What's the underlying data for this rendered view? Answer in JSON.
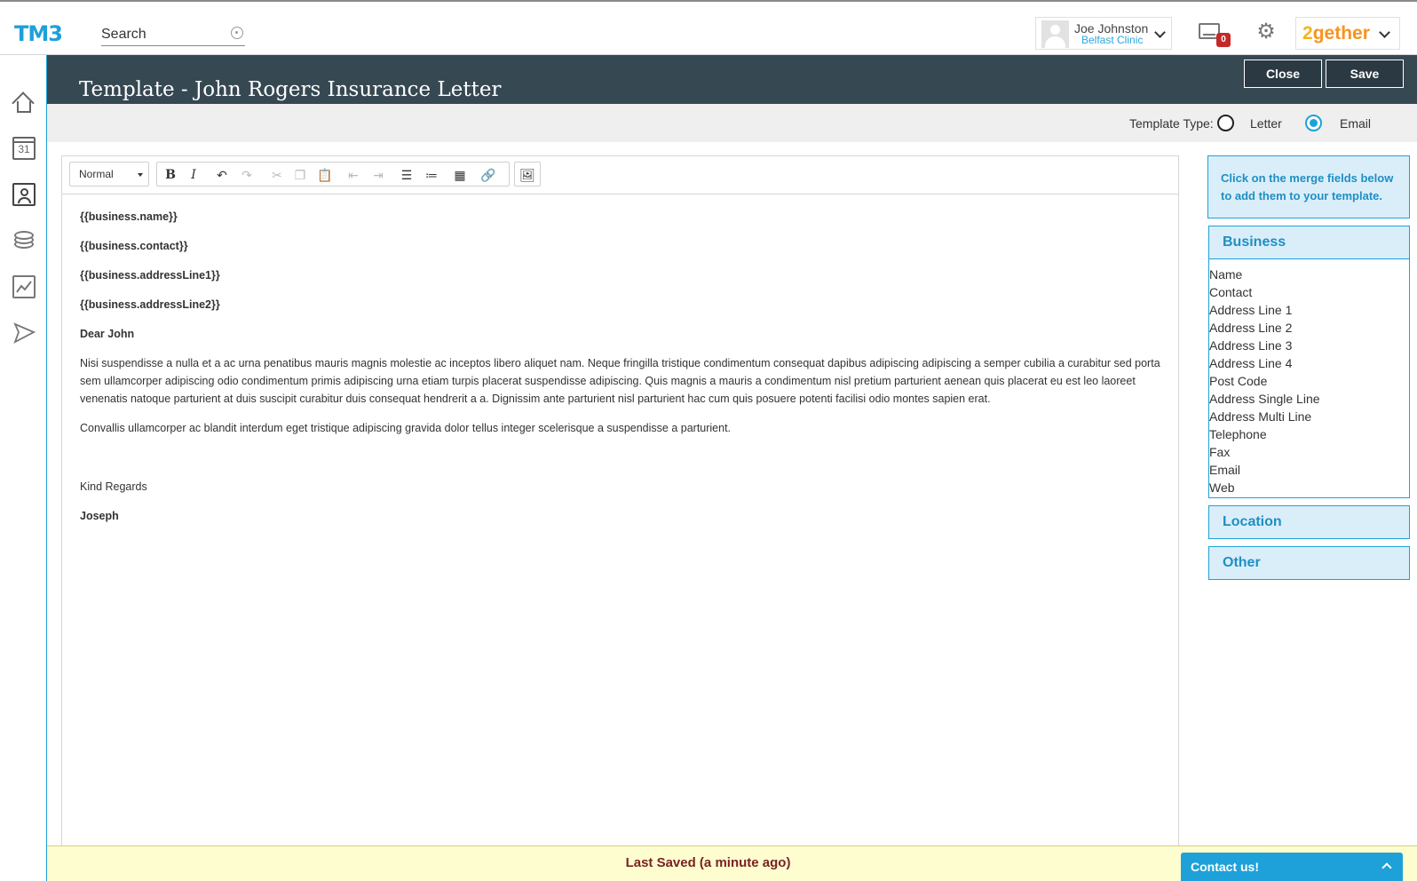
{
  "app": {
    "logo": "TM3"
  },
  "search": {
    "placeholder": "Search"
  },
  "user": {
    "name": "Joe Johnston",
    "clinic": "Belfast Clinic"
  },
  "inbox": {
    "count": "0"
  },
  "brand": {
    "part1": "2",
    "part2": "gether"
  },
  "nav": {
    "calendar_day": "31"
  },
  "header": {
    "title": "Template - John Rogers Insurance Letter",
    "close_label": "Close",
    "save_label": "Save"
  },
  "template_type": {
    "label": "Template Type:",
    "options": [
      "Letter",
      "Email"
    ],
    "selected": "Email"
  },
  "toolbar": {
    "style_select": "Normal"
  },
  "document": {
    "fields": [
      "{{business.name}}",
      "{{business.contact}}",
      "{{business.addressLine1}}",
      "{{business.addressLine2}}"
    ],
    "salutation": "Dear John",
    "paragraph1": "Nisi suspendisse a nulla et a ac urna penatibus mauris magnis molestie ac inceptos libero aliquet nam. Neque fringilla tristique condimentum consequat dapibus adipiscing adipiscing a semper cubilia a curabitur sed porta sem ullamcorper adipiscing odio condimentum primis adipiscing urna etiam turpis placerat suspendisse adipiscing. Quis magnis a mauris a condimentum nisl pretium parturient aenean quis placerat eu est leo laoreet venenatis natoque parturient at duis suscipit curabitur duis consequat hendrerit a a. Dignissim ante parturient nisl parturient hac cum quis posuere potenti facilisi odio montes sapien erat.",
    "paragraph2": "Convallis ullamcorper ac blandit interdum eget tristique adipiscing gravida dolor tellus integer scelerisque a suspendisse a parturient.",
    "closing": "Kind Regards",
    "signature": "Joseph"
  },
  "merge_panel": {
    "hint": "Click on the merge fields below to add them to your template.",
    "sections": [
      {
        "title": "Business",
        "items": [
          "Name",
          "Contact",
          "Address Line 1",
          "Address Line 2",
          "Address Line 3",
          "Address Line 4",
          "Post Code",
          "Address Single Line",
          "Address Multi Line",
          "Telephone",
          "Fax",
          "Email",
          "Web"
        ]
      },
      {
        "title": "Location"
      },
      {
        "title": "Other"
      }
    ]
  },
  "footer": {
    "status": "Last Saved (a minute ago)"
  },
  "contact": {
    "label": "Contact us!"
  }
}
